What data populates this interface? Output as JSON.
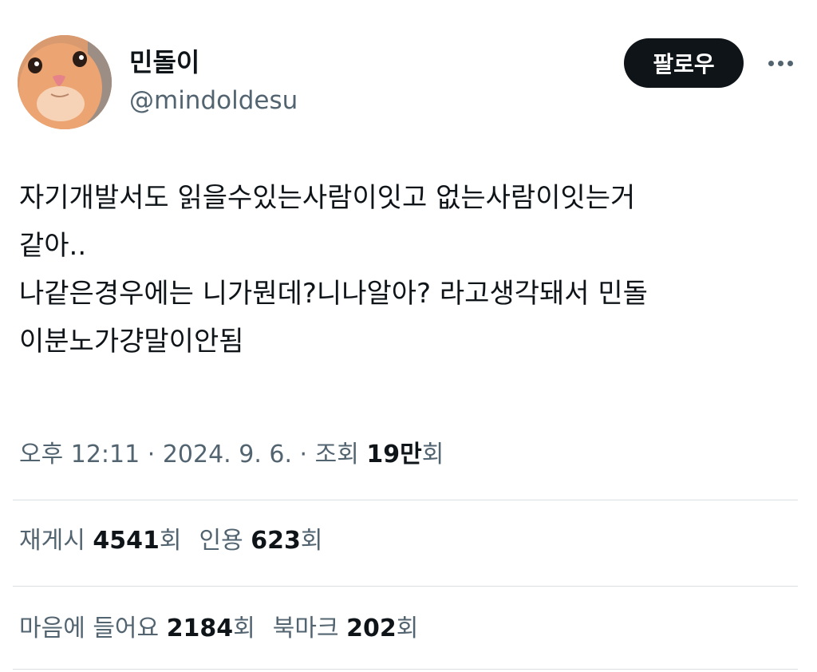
{
  "author": {
    "display_name": "민돌이",
    "handle": "@mindoldesu",
    "avatar_icon": "cat-face-avatar"
  },
  "header": {
    "follow_label": "팔로우",
    "more_icon": "more-horizontal-icon"
  },
  "tweet": {
    "lines": [
      "자기개발서도 읽을수있는사람이잇고 없는사람이잇는거",
      "같아..",
      "나같은경우에는 니가뭔데?니나알아? 라고생각돼서 민돌",
      "이분노가걍말이안됨"
    ]
  },
  "meta": {
    "time": "오후 12:11",
    "separator": " · ",
    "date": "2024. 9. 6.",
    "views_label": "조회",
    "views_number": "19만",
    "views_suffix": "회"
  },
  "stats": {
    "reposts_label": "재게시",
    "reposts_count": "4541",
    "reposts_suffix": "회",
    "quotes_label": "인용",
    "quotes_count": "623",
    "quotes_suffix": "회",
    "likes_label": "마음에 들어요",
    "likes_count": "2184",
    "likes_suffix": "회",
    "bookmarks_label": "북마크",
    "bookmarks_count": "202",
    "bookmarks_suffix": "회"
  },
  "colors": {
    "text_primary": "#0f1419",
    "text_secondary": "#536471",
    "divider": "#dadfe3",
    "button_bg": "#0f1419"
  }
}
